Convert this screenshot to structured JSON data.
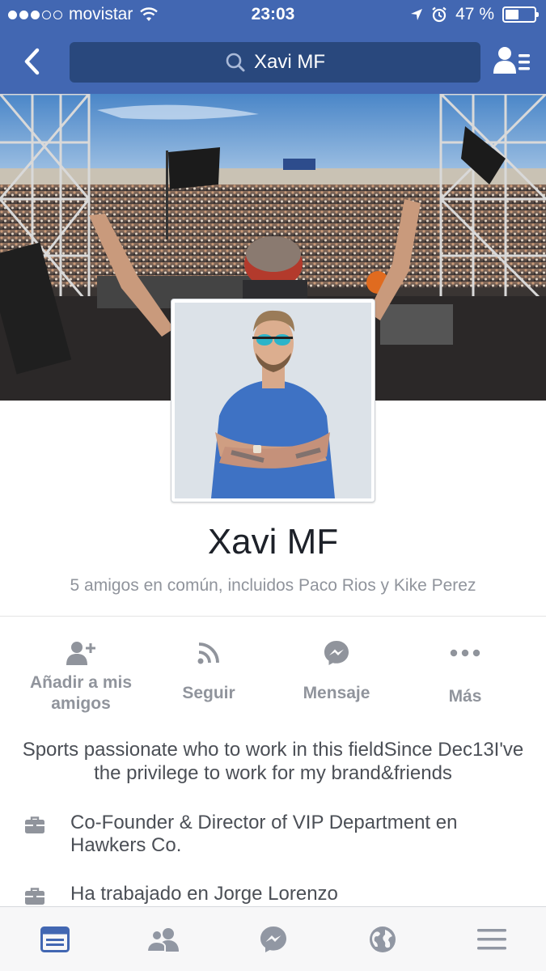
{
  "status_bar": {
    "carrier": "movistar",
    "time": "23:03",
    "battery": "47 %",
    "battery_level": 0.47,
    "signal_bars_filled": 3,
    "signal_bars_total": 5,
    "icons": [
      "wifi-icon",
      "location-arrow-icon",
      "alarm-icon",
      "battery-icon"
    ]
  },
  "nav": {
    "back_icon": "chevron-left-icon",
    "search_text": "Xavi MF",
    "search_icon": "search-icon",
    "friend_requests_icon": "friend-list-icon",
    "bar_color": "#4267b2",
    "search_bg_color": "#29487d"
  },
  "profile": {
    "name": "Xavi MF",
    "mutual_friends": "5 amigos en común, incluidos Paco Rios y Kike Perez"
  },
  "actions": [
    {
      "label": "Añadir a mis amigos",
      "icon": "add-friend-icon"
    },
    {
      "label": "Seguir",
      "icon": "rss-follow-icon"
    },
    {
      "label": "Mensaje",
      "icon": "messenger-icon"
    },
    {
      "label": "Más",
      "icon": "more-dots-icon"
    }
  ],
  "about": {
    "bio": "Sports passionate who to work in this fieldSince Dec13I've the privilege to work for my brand&friends",
    "work": [
      {
        "text": "Co-Founder & Director of VIP Department en Hawkers Co.",
        "icon": "briefcase-icon"
      },
      {
        "text": "Ha trabajado en Jorge Lorenzo",
        "icon": "briefcase-icon"
      }
    ]
  },
  "tabbar": {
    "active_color": "#4267b2",
    "inactive_color": "#9197a3",
    "tabs": [
      {
        "icon": "news-feed-icon",
        "active": true
      },
      {
        "icon": "friends-icon",
        "active": false
      },
      {
        "icon": "messenger-icon",
        "active": false
      },
      {
        "icon": "globe-notifications-icon",
        "active": false
      },
      {
        "icon": "menu-icon",
        "active": false
      }
    ]
  }
}
